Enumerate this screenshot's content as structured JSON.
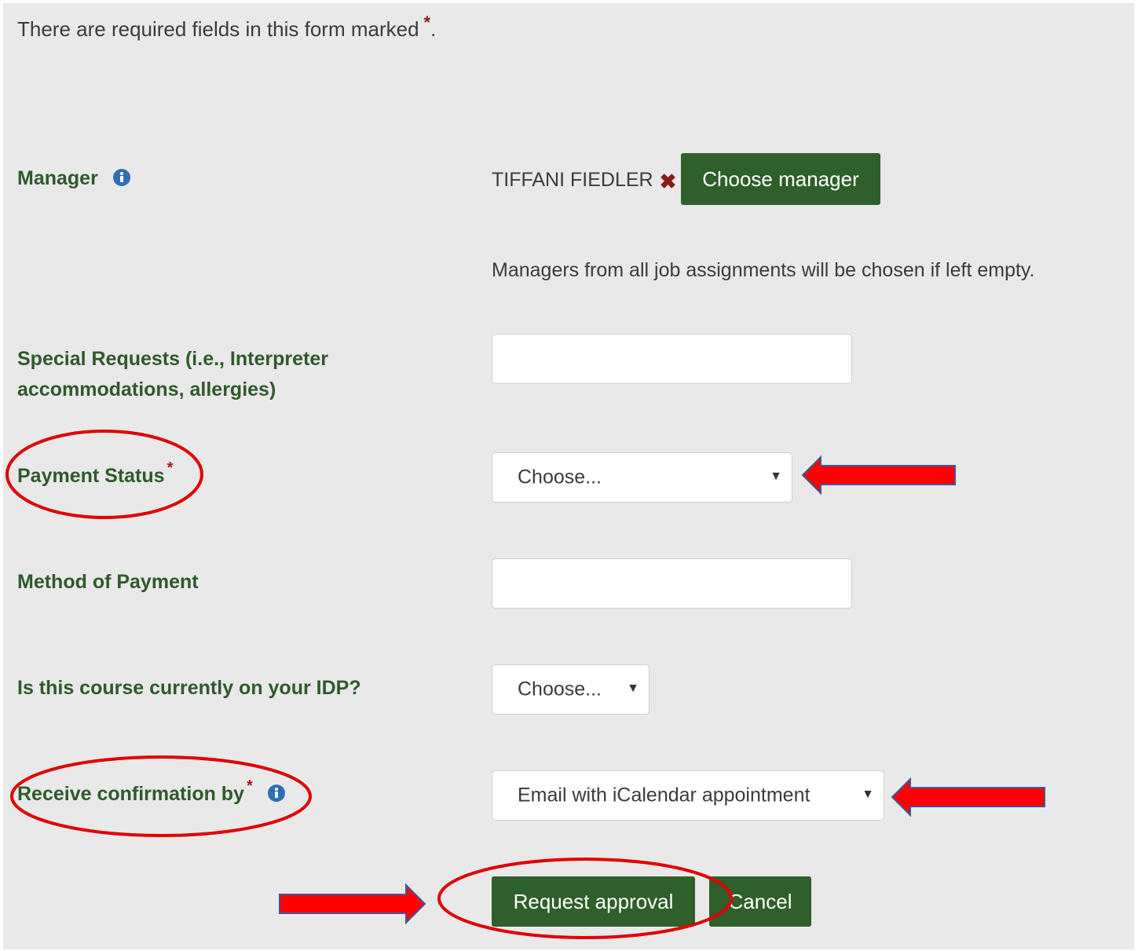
{
  "form": {
    "notice": "There are required fields in this form marked",
    "required_marker": "*",
    "notice_end": ".",
    "manager": {
      "label": "Manager",
      "selected_name": "TIFFANI FIEDLER",
      "remove_glyph": "✖",
      "choose_button": "Choose manager",
      "hint": "Managers from all job assignments will be chosen if left empty."
    },
    "special_requests": {
      "label": "Special Requests (i.e., Interpreter accommodations, allergies)",
      "value": ""
    },
    "payment_status": {
      "label": "Payment Status",
      "required_marker": "*",
      "selected": "Choose..."
    },
    "method_of_payment": {
      "label": "Method of Payment",
      "value": ""
    },
    "idp": {
      "label": "Is this course currently on your IDP?",
      "selected": "Choose..."
    },
    "confirmation": {
      "label": "Receive confirmation by",
      "required_marker": "*",
      "selected": "Email with iCalendar appointment"
    },
    "actions": {
      "request_approval": "Request approval",
      "cancel": "Cancel"
    }
  },
  "icons": {
    "info": "info-icon",
    "caret": "caret-down-icon",
    "remove": "close-icon"
  },
  "colors": {
    "primary_green": "#2f5f2b",
    "label_green": "#2e5a2a",
    "annotation_red": "#e00000",
    "required_star": "#b01818",
    "info_blue": "#2f6db5"
  }
}
